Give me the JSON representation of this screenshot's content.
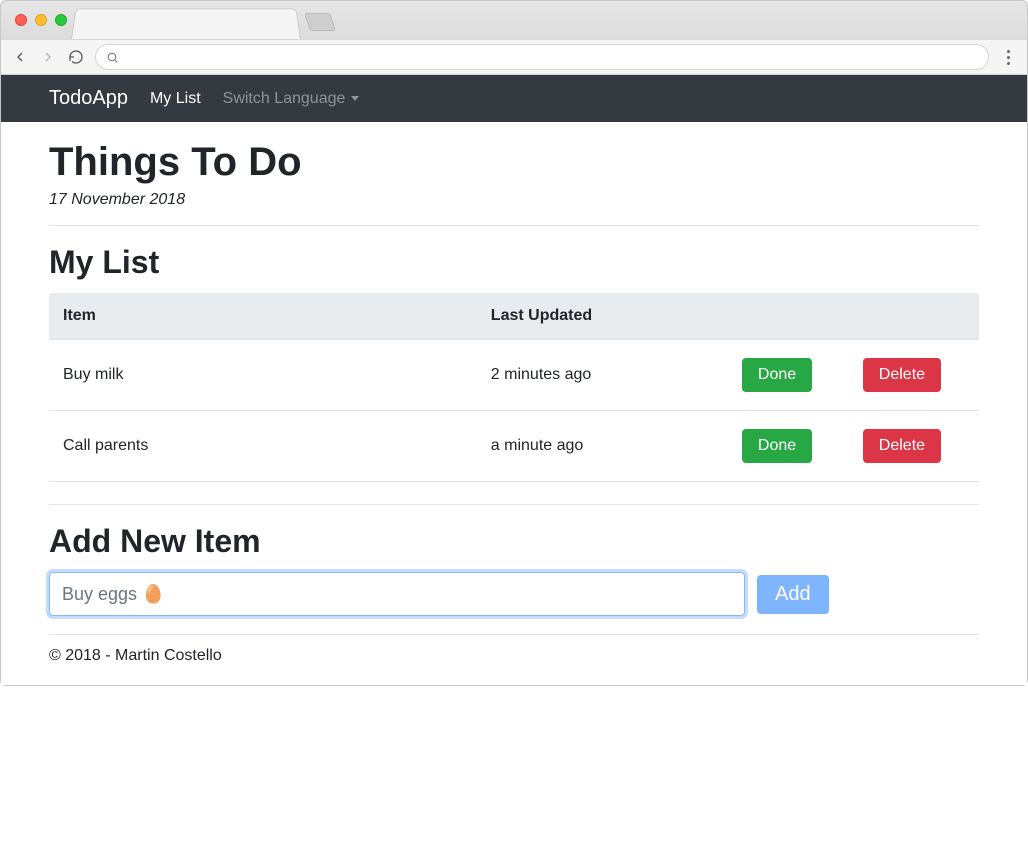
{
  "nav": {
    "brand": "TodoApp",
    "link_mylist": "My List",
    "link_switch_language": "Switch Language"
  },
  "page": {
    "title": "Things To Do",
    "date": "17 November 2018",
    "section_list": "My List",
    "section_add": "Add New Item"
  },
  "table": {
    "col_item": "Item",
    "col_updated": "Last Updated",
    "rows": [
      {
        "item": "Buy milk",
        "updated": "2 minutes ago"
      },
      {
        "item": "Call parents",
        "updated": "a minute ago"
      }
    ],
    "done_label": "Done",
    "delete_label": "Delete"
  },
  "add": {
    "placeholder": "Buy eggs 🥚",
    "button": "Add"
  },
  "footer": {
    "text": "© 2018 - Martin Costello"
  }
}
